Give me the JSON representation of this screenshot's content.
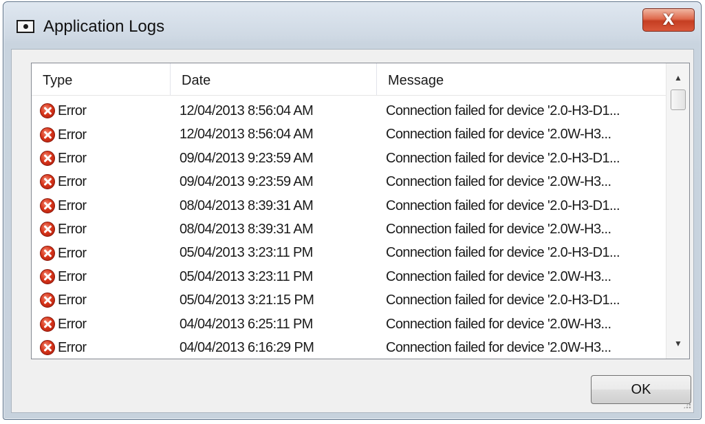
{
  "window": {
    "title": "Application Logs",
    "icon": "window-app-icon",
    "close_label": "X"
  },
  "list": {
    "columns": [
      "Type",
      "Date",
      "Message"
    ],
    "rows": [
      {
        "type": "Error",
        "icon": "error-icon",
        "date": "12/04/2013 8:56:04 AM",
        "message": "Connection failed for device '2.0-H3-D1..."
      },
      {
        "type": "Error",
        "icon": "error-icon",
        "date": "12/04/2013 8:56:04 AM",
        "message": "Connection failed for device '2.0W-H3..."
      },
      {
        "type": "Error",
        "icon": "error-icon",
        "date": "09/04/2013 9:23:59 AM",
        "message": "Connection failed for device '2.0-H3-D1..."
      },
      {
        "type": "Error",
        "icon": "error-icon",
        "date": "09/04/2013 9:23:59 AM",
        "message": "Connection failed for device '2.0W-H3..."
      },
      {
        "type": "Error",
        "icon": "error-icon",
        "date": "08/04/2013 8:39:31 AM",
        "message": "Connection failed for device '2.0-H3-D1..."
      },
      {
        "type": "Error",
        "icon": "error-icon",
        "date": "08/04/2013 8:39:31 AM",
        "message": "Connection failed for device '2.0W-H3..."
      },
      {
        "type": "Error",
        "icon": "error-icon",
        "date": "05/04/2013 3:23:11 PM",
        "message": "Connection failed for device '2.0-H3-D1..."
      },
      {
        "type": "Error",
        "icon": "error-icon",
        "date": "05/04/2013 3:23:11 PM",
        "message": "Connection failed for device '2.0W-H3..."
      },
      {
        "type": "Error",
        "icon": "error-icon",
        "date": "05/04/2013 3:21:15 PM",
        "message": "Connection failed for device '2.0-H3-D1..."
      },
      {
        "type": "Error",
        "icon": "error-icon",
        "date": "04/04/2013 6:25:11 PM",
        "message": "Connection failed for device '2.0W-H3..."
      },
      {
        "type": "Error",
        "icon": "error-icon",
        "date": "04/04/2013 6:16:29 PM",
        "message": "Connection failed for device '2.0W-H3..."
      }
    ]
  },
  "footer": {
    "ok_label": "OK"
  },
  "colors": {
    "close_button": "#d9573a",
    "error_icon": "#d9361b",
    "frame": "#cfd9e4"
  }
}
